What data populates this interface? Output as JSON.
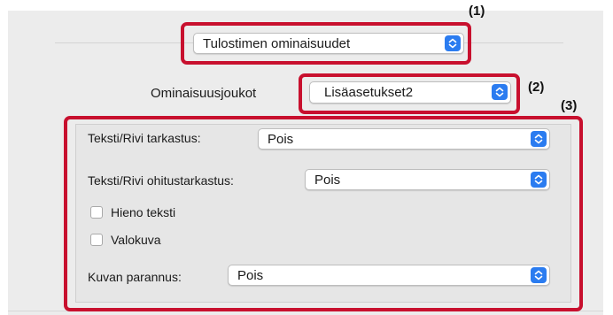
{
  "callouts": {
    "one": "(1)",
    "two": "(2)",
    "three": "(3)"
  },
  "printer_features": {
    "value": "Tulostimen ominaisuudet"
  },
  "feature_sets": {
    "label": "Ominaisuusjoukot",
    "value": "Lisäasetukset2"
  },
  "text_line_check": {
    "label": "Teksti/Rivi tarkastus:",
    "value": "Pois"
  },
  "text_line_skip_check": {
    "label": "Teksti/Rivi ohitustarkastus:",
    "value": "Pois"
  },
  "fine_text": {
    "label": "Hieno teksti",
    "checked": false
  },
  "photo": {
    "label": "Valokuva",
    "checked": false
  },
  "image_enhancement": {
    "label": "Kuvan parannus:",
    "value": "Pois"
  },
  "colors": {
    "callout": "#c8102e",
    "stepper": "#2b7cf0"
  },
  "icons": {
    "stepper": "chevron-up-down-icon"
  }
}
